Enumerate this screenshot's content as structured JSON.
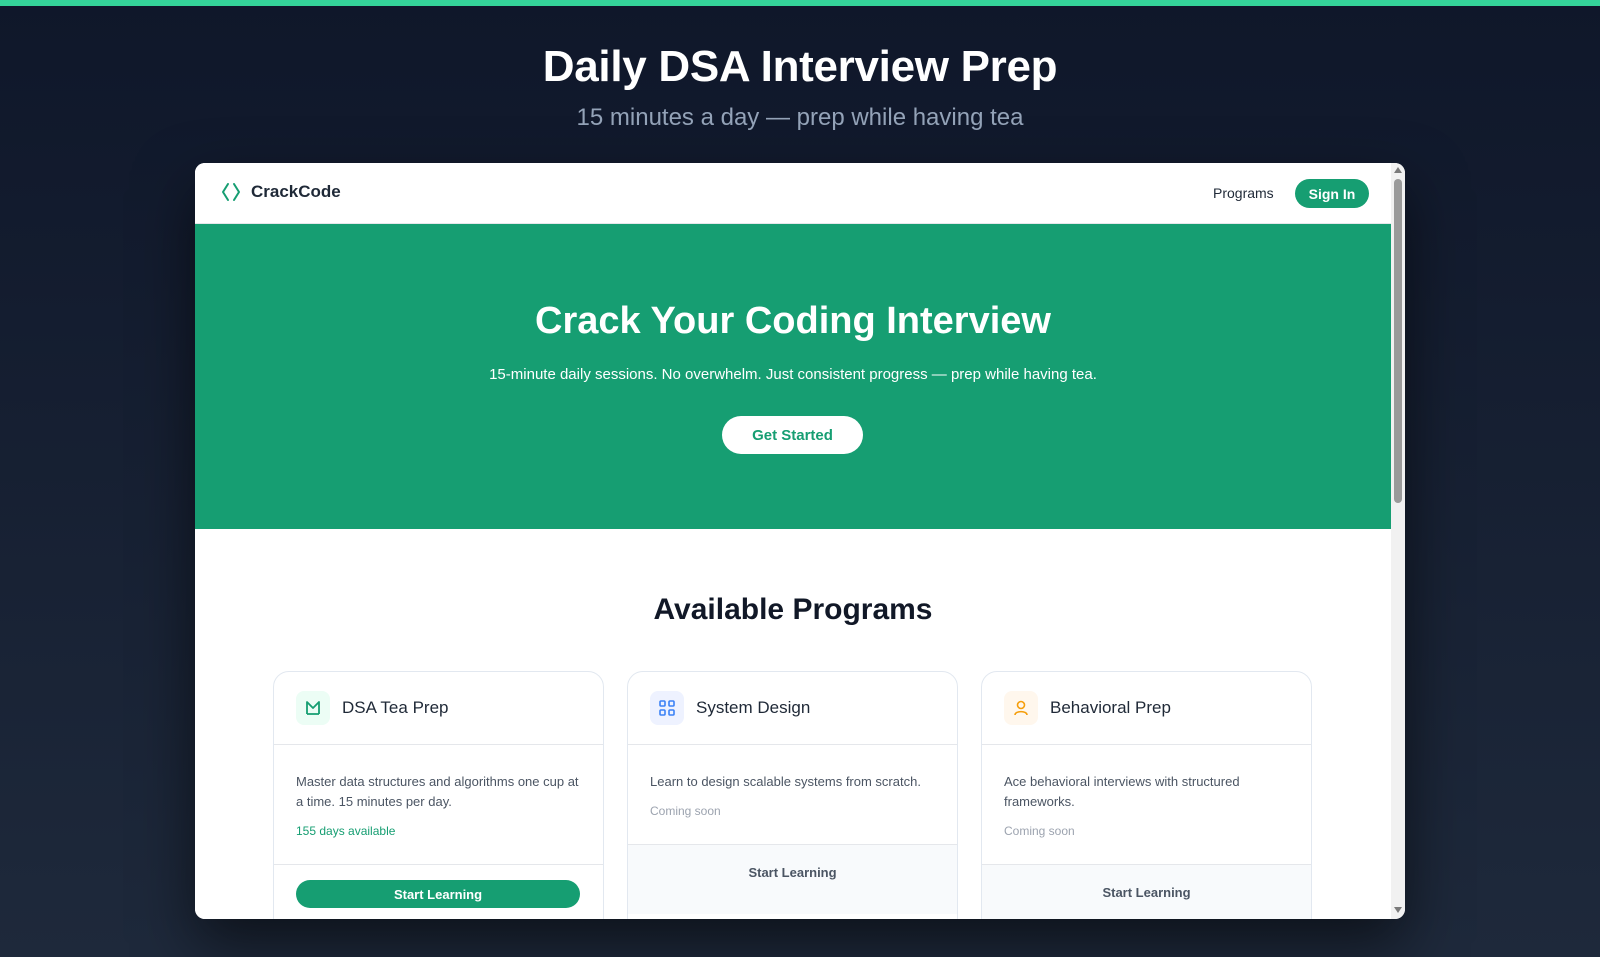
{
  "page": {
    "title": "Daily DSA Interview Prep",
    "subtitle": "15 minutes a day — prep while having tea"
  },
  "navbar": {
    "brand": "CrackCode",
    "programs_link": "Programs",
    "signin_label": "Sign In"
  },
  "hero": {
    "title": "Crack Your Coding Interview",
    "subtitle": "15-minute daily sessions. No overwhelm. Just consistent progress — prep while having tea.",
    "cta_label": "Get Started"
  },
  "programs": {
    "heading": "Available Programs",
    "cards": [
      {
        "title": "DSA Tea Prep",
        "description": "Master data structures and algorithms one cup at a time. 15 minutes per day.",
        "meta": "155 days available",
        "button": "Start Learning",
        "icon": "chart-icon"
      },
      {
        "title": "System Design",
        "description": "Learn to design scalable systems from scratch.",
        "meta": "Coming soon",
        "button": "Start Learning",
        "icon": "architecture-icon"
      },
      {
        "title": "Behavioral Prep",
        "description": "Ace behavioral interviews with structured frameworks.",
        "meta": "Coming soon",
        "button": "Start Learning",
        "icon": "person-icon"
      }
    ]
  },
  "colors": {
    "accent": "#169e72",
    "top_bar": "#34d399",
    "background": "#0f172a"
  }
}
